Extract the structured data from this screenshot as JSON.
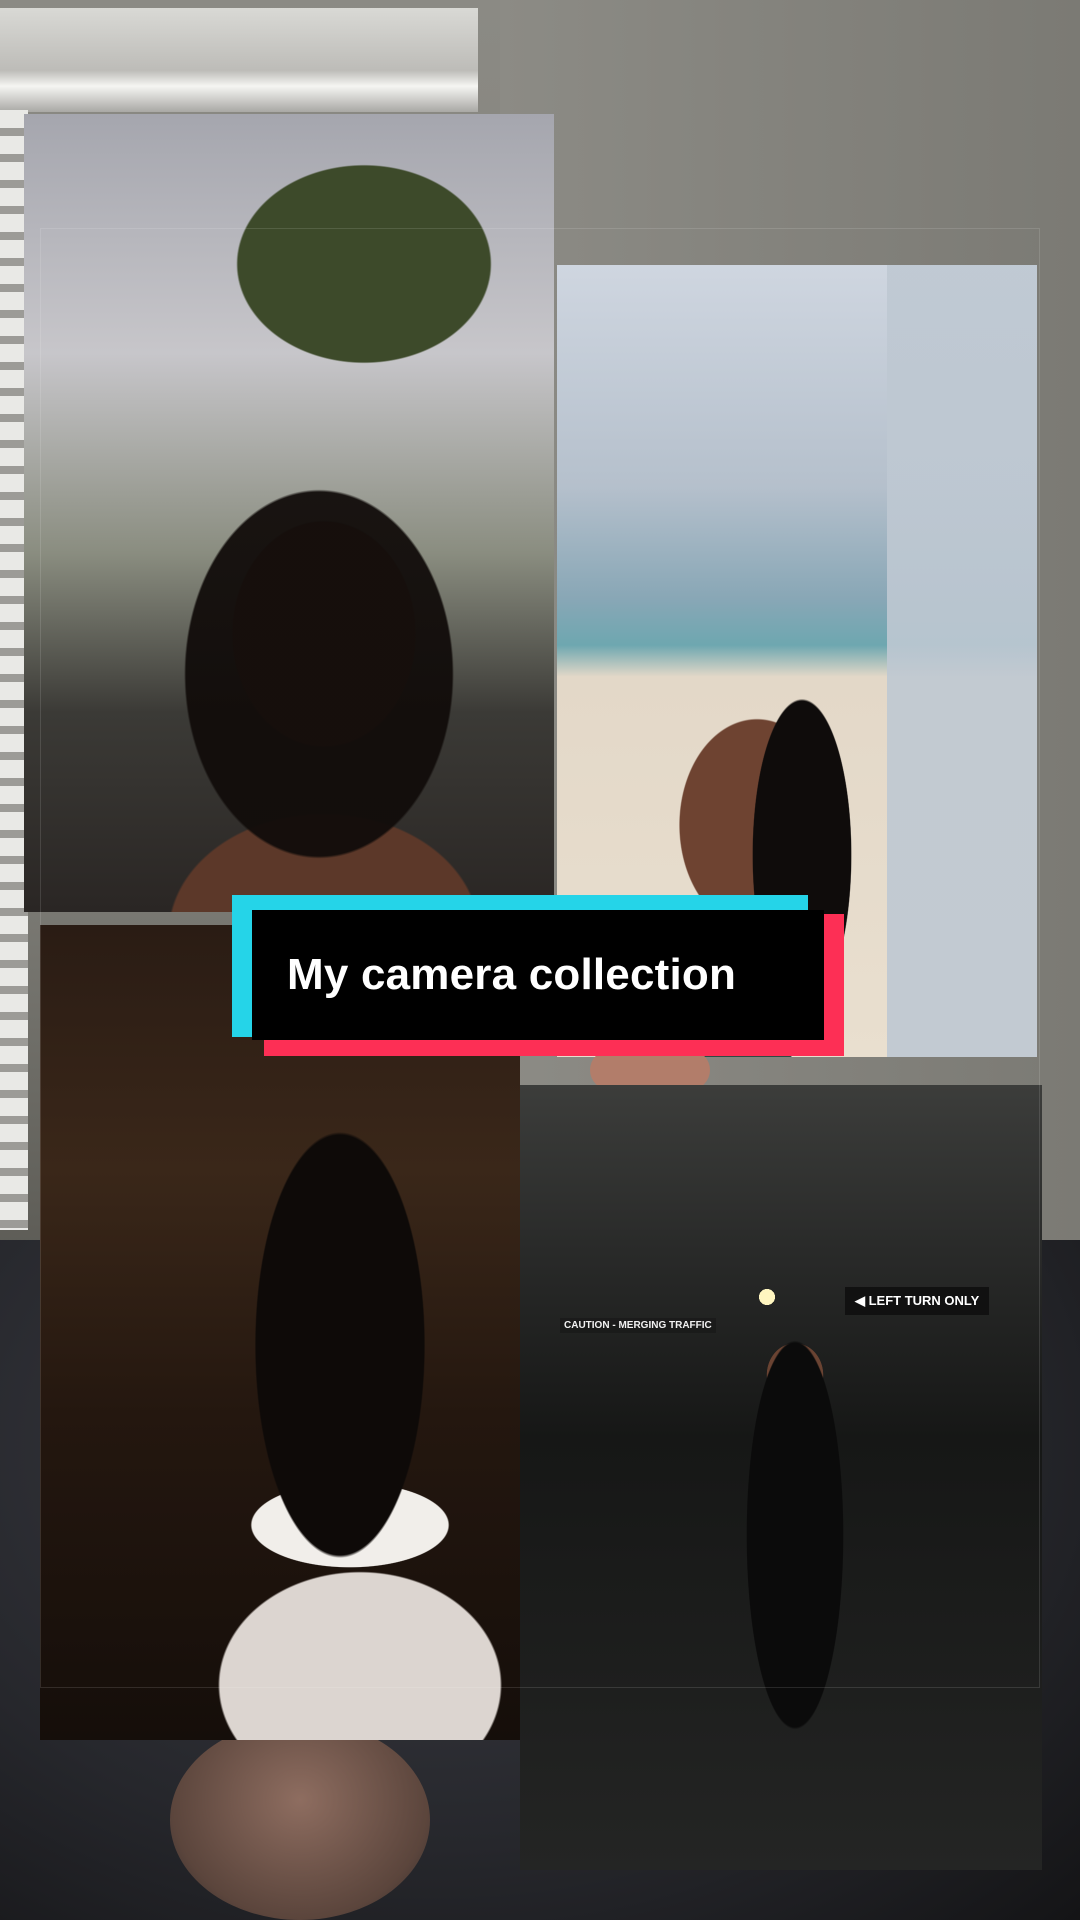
{
  "caption": {
    "text": "My camera collection"
  },
  "photos": [
    {
      "label": "Selfie in front of apartments"
    },
    {
      "label": "Beach photo"
    },
    {
      "label": "Indoor portrait in white lace"
    },
    {
      "label": "Parking garage full-length photo"
    }
  ],
  "signs": {
    "caution": "CAUTION - MERGING TRAFFIC",
    "left_turn": "◀ LEFT TURN ONLY"
  },
  "colors": {
    "cyan": "#25d4e8",
    "red": "#fd2f55",
    "caption_bg": "#000000"
  }
}
